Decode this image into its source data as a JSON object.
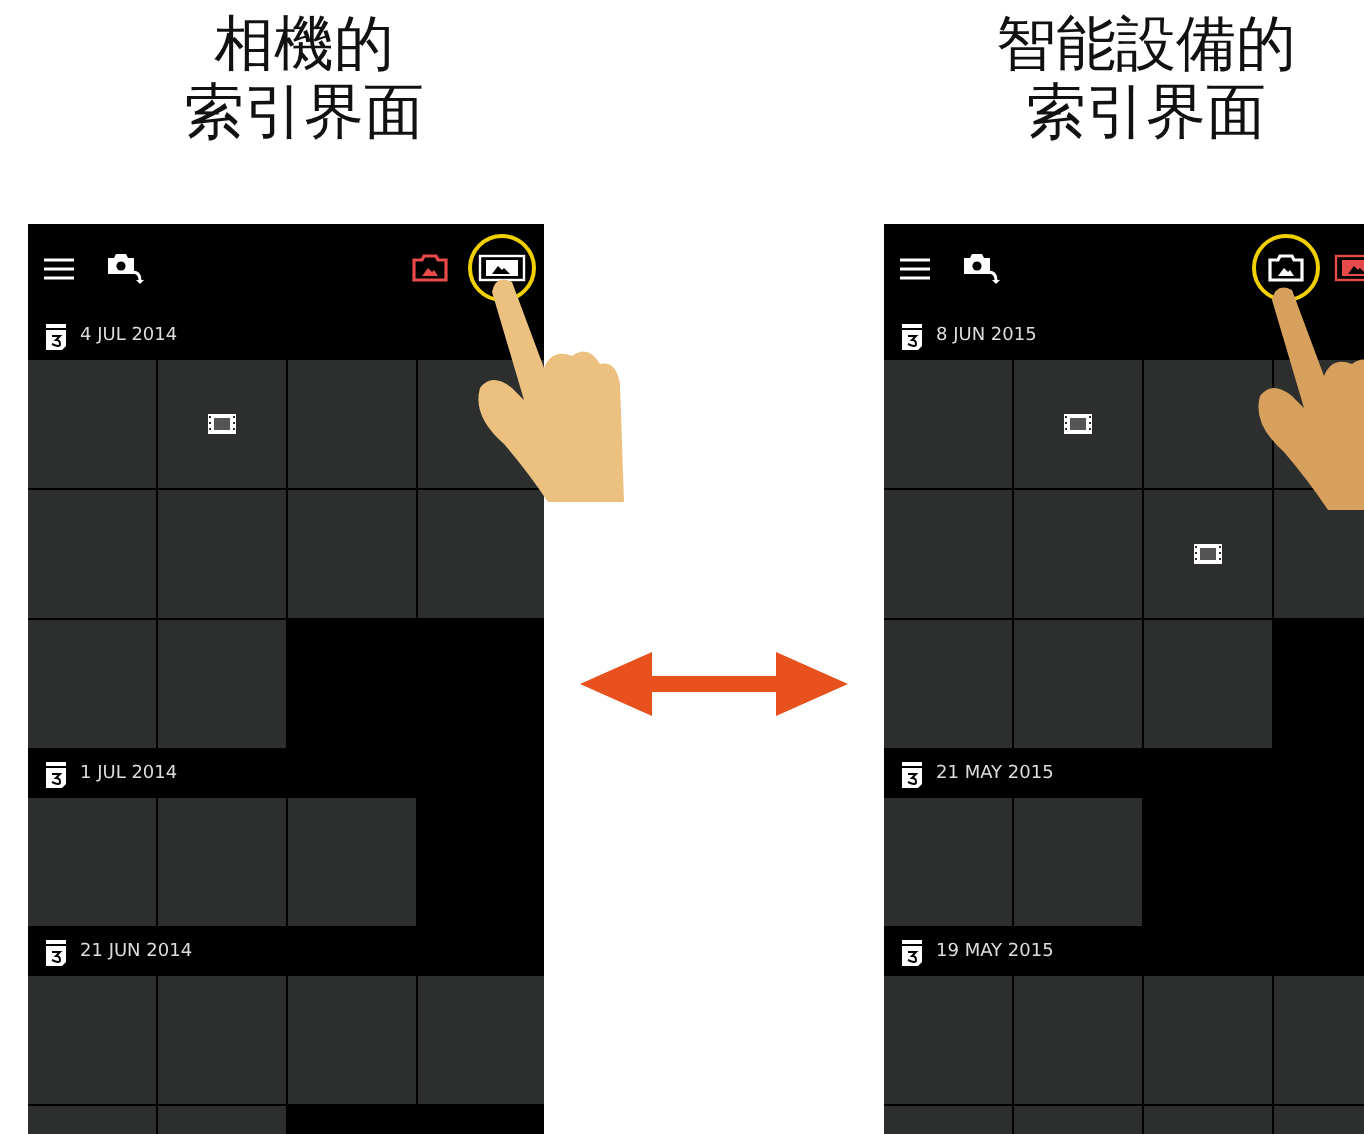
{
  "captions": [
    {
      "lines": [
        "相機的",
        "索引界面"
      ]
    },
    {
      "lines": [
        "智能設備的",
        "索引界面"
      ]
    }
  ],
  "phones": [
    {
      "tabs": [
        {
          "kind": "camera",
          "selected": true,
          "tapped": false
        },
        {
          "kind": "picture",
          "selected": false,
          "tapped": true
        }
      ],
      "groups": [
        {
          "date": "4 JUL 2014",
          "tiles": [
            {
              "kind": "photo"
            },
            {
              "kind": "video"
            },
            {
              "kind": "photo"
            },
            {
              "kind": "photo"
            },
            {
              "kind": "photo"
            },
            {
              "kind": "photo"
            },
            {
              "kind": "photo"
            },
            {
              "kind": "photo"
            },
            {
              "kind": "photo"
            },
            {
              "kind": "photo"
            }
          ]
        },
        {
          "date": "1 JUL 2014",
          "tiles": [
            {
              "kind": "photo"
            },
            {
              "kind": "photo"
            },
            {
              "kind": "photo"
            }
          ]
        },
        {
          "date": "21 JUN 2014",
          "tiles": [
            {
              "kind": "photo"
            },
            {
              "kind": "photo"
            },
            {
              "kind": "photo"
            },
            {
              "kind": "photo"
            },
            {
              "kind": "photo"
            },
            {
              "kind": "photo"
            }
          ]
        }
      ]
    },
    {
      "tabs": [
        {
          "kind": "camera",
          "selected": false,
          "tapped": true
        },
        {
          "kind": "picture",
          "selected": true,
          "tapped": false
        }
      ],
      "groups": [
        {
          "date": "8 JUN 2015",
          "tiles": [
            {
              "kind": "photo"
            },
            {
              "kind": "video"
            },
            {
              "kind": "photo"
            },
            {
              "kind": "photo"
            },
            {
              "kind": "photo"
            },
            {
              "kind": "photo"
            },
            {
              "kind": "video"
            },
            {
              "kind": "photo"
            },
            {
              "kind": "photo"
            },
            {
              "kind": "photo"
            },
            {
              "kind": "photo"
            }
          ]
        },
        {
          "date": "21 MAY 2015",
          "tiles": [
            {
              "kind": "photo"
            },
            {
              "kind": "photo"
            }
          ]
        },
        {
          "date": "19 MAY 2015",
          "tiles": [
            {
              "kind": "photo"
            },
            {
              "kind": "photo"
            },
            {
              "kind": "photo"
            },
            {
              "kind": "photo"
            },
            {
              "kind": "photo"
            },
            {
              "kind": "photo"
            },
            {
              "kind": "photo"
            },
            {
              "kind": "photo"
            }
          ]
        }
      ]
    }
  ]
}
